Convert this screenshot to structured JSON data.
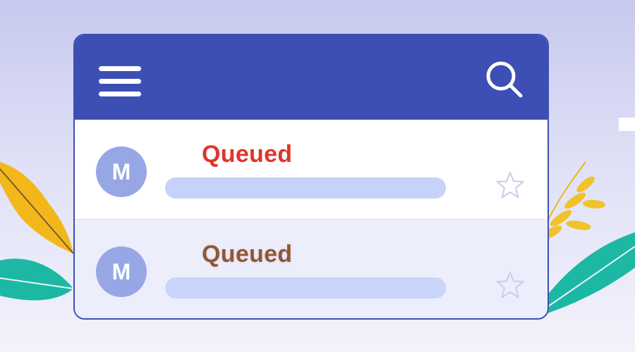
{
  "colors": {
    "appbar": "#3d4fb5",
    "avatar": "#97a7e6",
    "status_queued_primary": "#e0352b",
    "status_queued_secondary": "#8a5a35",
    "preview_bar": "#c6d2fa",
    "star_outline": "#c8cdea"
  },
  "appbar": {
    "menu_icon": "hamburger-menu-icon",
    "search_icon": "search-icon"
  },
  "messages": [
    {
      "avatar_initial": "M",
      "status": "Queued",
      "star_icon": "star-outline-icon"
    },
    {
      "avatar_initial": "M",
      "status": "Queued",
      "star_icon": "star-outline-icon"
    }
  ]
}
